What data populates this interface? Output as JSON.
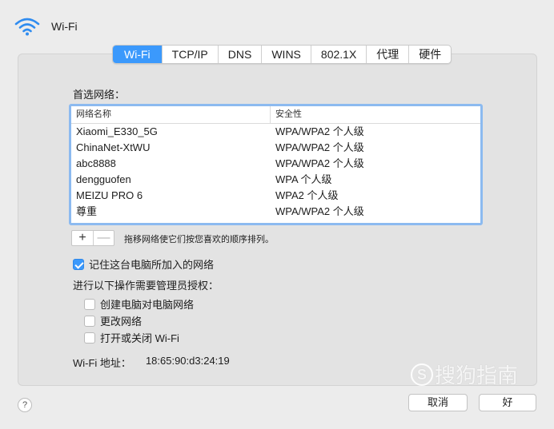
{
  "header": {
    "title": "Wi-Fi"
  },
  "tabs": [
    {
      "label": "Wi-Fi",
      "active": true
    },
    {
      "label": "TCP/IP"
    },
    {
      "label": "DNS"
    },
    {
      "label": "WINS"
    },
    {
      "label": "802.1X"
    },
    {
      "label": "代理"
    },
    {
      "label": "硬件"
    }
  ],
  "preferred": {
    "label": "首选网络：",
    "columns": {
      "name": "网络名称",
      "security": "安全性"
    },
    "rows": [
      {
        "name": "Xiaomi_E330_5G",
        "security": "WPA/WPA2 个人级"
      },
      {
        "name": "ChinaNet-XtWU",
        "security": "WPA/WPA2 个人级"
      },
      {
        "name": "abc8888",
        "security": "WPA/WPA2 个人级"
      },
      {
        "name": "dengguofen",
        "security": "WPA 个人级"
      },
      {
        "name": "MEIZU PRO 6",
        "security": "WPA2 个人级"
      },
      {
        "name": "尊重",
        "security": "WPA/WPA2 个人级"
      }
    ],
    "plus": "+",
    "minus": "—",
    "hint": "拖移网络使它们按您喜欢的顺序排列。"
  },
  "remember": {
    "label": "记住这台电脑所加入的网络",
    "checked": true
  },
  "admin": {
    "label": "进行以下操作需要管理员授权：",
    "options": [
      {
        "label": "创建电脑对电脑网络",
        "checked": false
      },
      {
        "label": "更改网络",
        "checked": false
      },
      {
        "label": "打开或关闭 Wi-Fi",
        "checked": false
      }
    ]
  },
  "wifi_address": {
    "label": "Wi-Fi 地址：",
    "value": "18:65:90:d3:24:19"
  },
  "footer": {
    "help": "?",
    "cancel": "取消",
    "ok": "好"
  },
  "watermark": {
    "logo": "S",
    "text": "搜狗指南"
  },
  "colors": {
    "accent": "#3b99fc",
    "panel": "#e3e3e3",
    "background": "#ececec"
  }
}
